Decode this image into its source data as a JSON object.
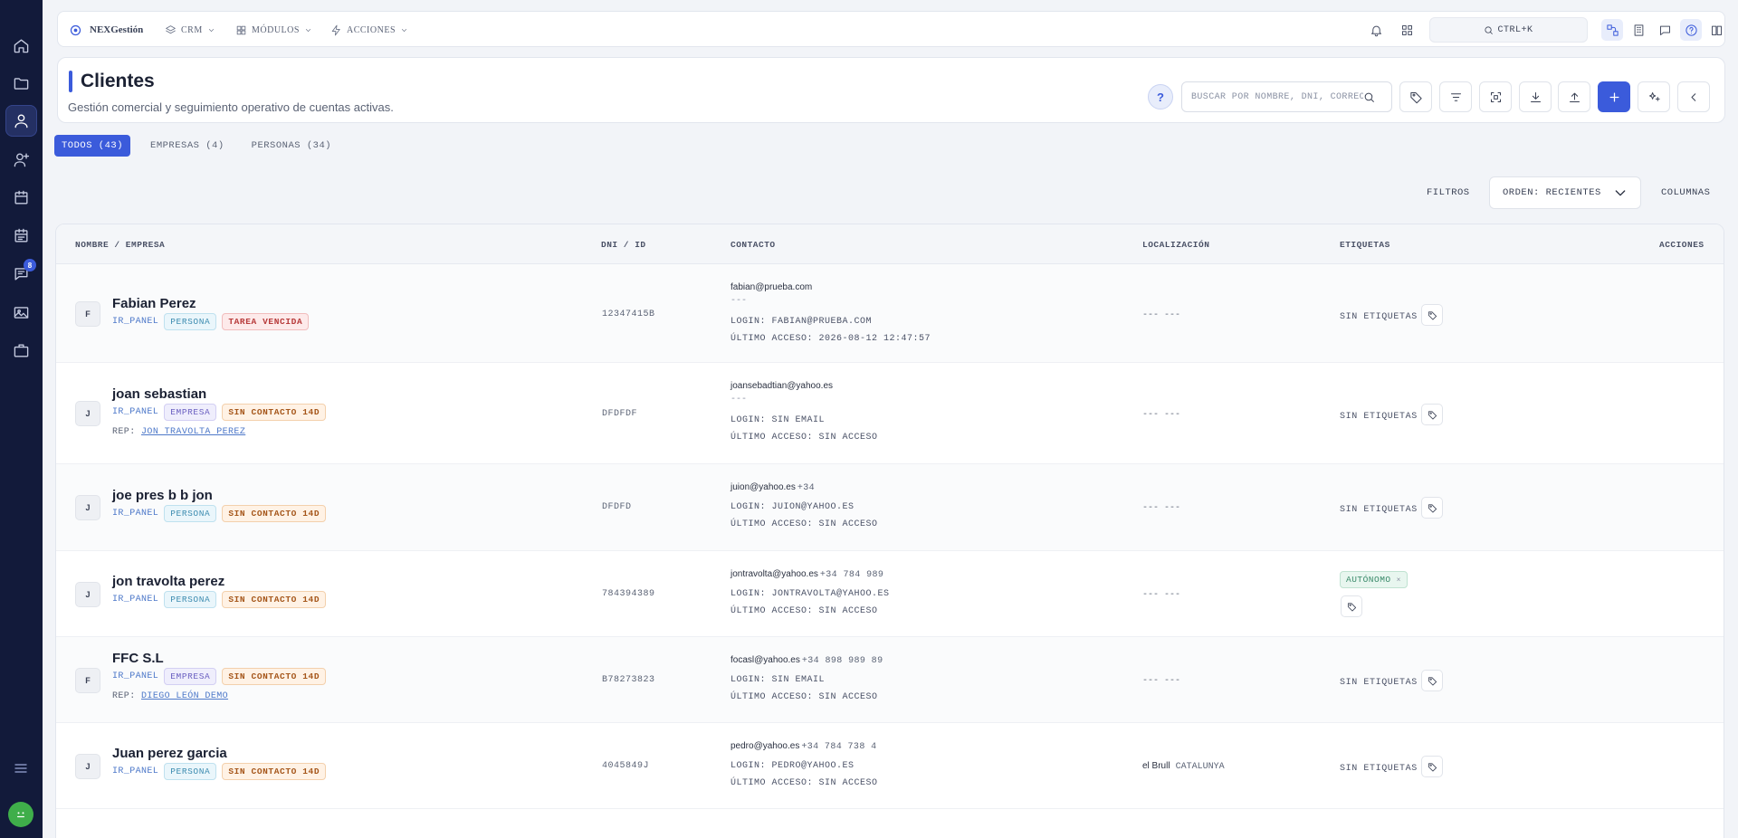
{
  "app": {
    "name": "NEXGestión",
    "nav": [
      "CRM",
      "MÓDULOS",
      "ACCIONES"
    ],
    "search_shortcut": "CTRL+K"
  },
  "sidebar": {
    "messages_badge": "8"
  },
  "page": {
    "title": "Clientes",
    "subtitle": "Gestión comercial y seguimiento operativo de cuentas activas.",
    "help": "?",
    "search_placeholder": "BUSCAR POR NOMBRE, DNI, CORREO"
  },
  "tabs": [
    "TODOS (43)",
    "EMPRESAS (4)",
    "PERSONAS (34)"
  ],
  "toolbar": {
    "filters": "FILTROS",
    "order": "ORDEN: RECIENTES",
    "columns": "COLUMNAS"
  },
  "table": {
    "headers": [
      "NOMBRE / EMPRESA",
      "DNI / ID",
      "CONTACTO",
      "LOCALIZACIÓN",
      "ETIQUETAS",
      "ACCIONES"
    ],
    "rows": [
      {
        "initial": "F",
        "name": "Fabian Perez",
        "source": "IR_PANEL",
        "type": "PERSONA",
        "status": "TAREA VENCIDA",
        "dni": "12347415B",
        "email": "fabian@prueba.com",
        "phone": "",
        "dash": "---",
        "login": "LOGIN: FABIAN@PRUEBA.COM",
        "access": "ÚLTIMO ACCESO: 2026-08-12 12:47:57",
        "loc_city": "",
        "loc_region": "--- ---",
        "tags": "SIN ETIQUETAS"
      },
      {
        "initial": "J",
        "name": "joan sebastian",
        "source": "IR_PANEL",
        "type": "EMPRESA",
        "status": "SIN CONTACTO 14D",
        "rep_label": "REP:",
        "rep": "JON TRAVOLTA PEREZ",
        "dni": "DFDFDF",
        "email": "joansebadtian@yahoo.es",
        "phone": "",
        "dash": "---",
        "login": "LOGIN: SIN EMAIL",
        "access": "ÚLTIMO ACCESO: SIN ACCESO",
        "loc_city": "",
        "loc_region": "--- ---",
        "tags": "SIN ETIQUETAS"
      },
      {
        "initial": "J",
        "name": "joe pres b b jon",
        "source": "IR_PANEL",
        "type": "PERSONA",
        "status": "SIN CONTACTO 14D",
        "dni": "DFDFD",
        "email": "juion@yahoo.es",
        "phone": "+34",
        "login": "LOGIN: JUION@YAHOO.ES",
        "access": "ÚLTIMO ACCESO: SIN ACCESO",
        "loc_city": "",
        "loc_region": "--- ---",
        "tags": "SIN ETIQUETAS"
      },
      {
        "initial": "J",
        "name": "jon travolta perez",
        "source": "IR_PANEL",
        "type": "PERSONA",
        "status": "SIN CONTACTO 14D",
        "dni": "784394389",
        "email": "jontravolta@yahoo.es",
        "phone": "+34 784 989",
        "login": "LOGIN: JONTRAVOLTA@YAHOO.ES",
        "access": "ÚLTIMO ACCESO: SIN ACCESO",
        "loc_city": "",
        "loc_region": "--- ---",
        "tags": "AUTÓNOMO",
        "tag_remove": "×"
      },
      {
        "initial": "F",
        "name": "FFC S.L",
        "source": "IR_PANEL",
        "type": "EMPRESA",
        "status": "SIN CONTACTO 14D",
        "rep_label": "REP:",
        "rep": "DIEGO LEÓN DEMO",
        "dni": "B78273823",
        "email": "focasl@yahoo.es",
        "phone": "+34 898 989 89",
        "login": "LOGIN: SIN EMAIL",
        "access": "ÚLTIMO ACCESO: SIN ACCESO",
        "loc_city": "",
        "loc_region": "--- ---",
        "tags": "SIN ETIQUETAS"
      },
      {
        "initial": "J",
        "name": "Juan perez garcia",
        "source": "IR_PANEL",
        "type": "PERSONA",
        "status": "SIN CONTACTO 14D",
        "dni": "4045849J",
        "email": "pedro@yahoo.es",
        "phone": "+34 784 738 4",
        "login": "LOGIN: PEDRO@YAHOO.ES",
        "access": "ÚLTIMO ACCESO: SIN ACCESO",
        "loc_city": "el Brull",
        "loc_region": "CATALUNYA",
        "tags": "SIN ETIQUETAS"
      }
    ]
  }
}
